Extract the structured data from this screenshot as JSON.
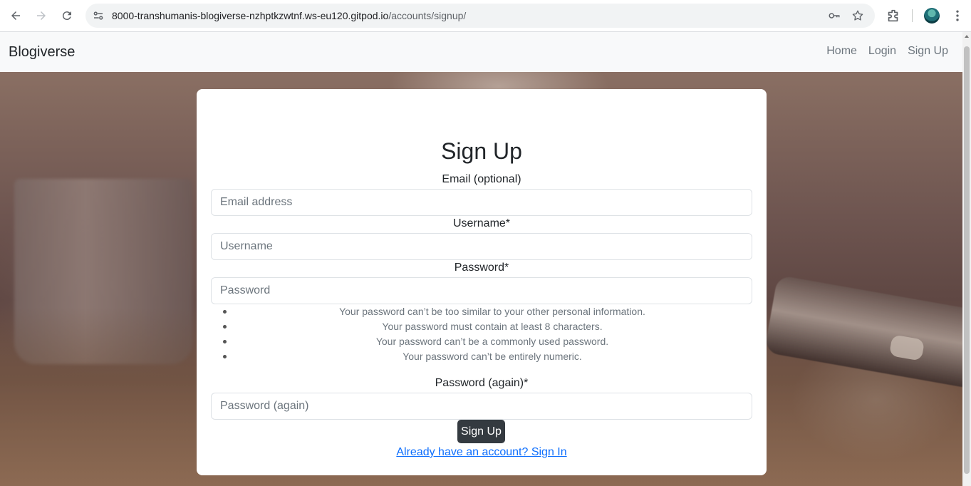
{
  "browser": {
    "url_host": "8000-transhumanis-blogiverse-nzhptkzwtnf.ws-eu120.gitpod.io",
    "url_path": "/accounts/signup/",
    "icons": [
      "back-icon",
      "forward-icon",
      "reload-icon",
      "site-info-icon",
      "password-key-icon",
      "bookmark-star-icon",
      "extensions-icon",
      "profile-avatar",
      "menu-dots-icon"
    ]
  },
  "navbar": {
    "brand": "Blogiverse",
    "links": [
      {
        "label": "Home"
      },
      {
        "label": "Login"
      },
      {
        "label": "Sign Up"
      }
    ]
  },
  "form": {
    "title": "Sign Up",
    "email_label": "Email (optional)",
    "email_placeholder": "Email address",
    "username_label": "Username*",
    "username_placeholder": "Username",
    "password_label": "Password*",
    "password_placeholder": "Password",
    "password_help": [
      "Your password can’t be too similar to your other personal information.",
      "Your password must contain at least 8 characters.",
      "Your password can’t be a commonly used password.",
      "Your password can’t be entirely numeric."
    ],
    "password2_label": "Password (again)*",
    "password2_placeholder": "Password (again)",
    "submit_label": "Sign Up",
    "signin_link": "Already have an account? Sign In"
  },
  "colors": {
    "button_bg": "#343a40",
    "link": "#0d6efd",
    "navbar_bg": "#f8f9fa"
  }
}
